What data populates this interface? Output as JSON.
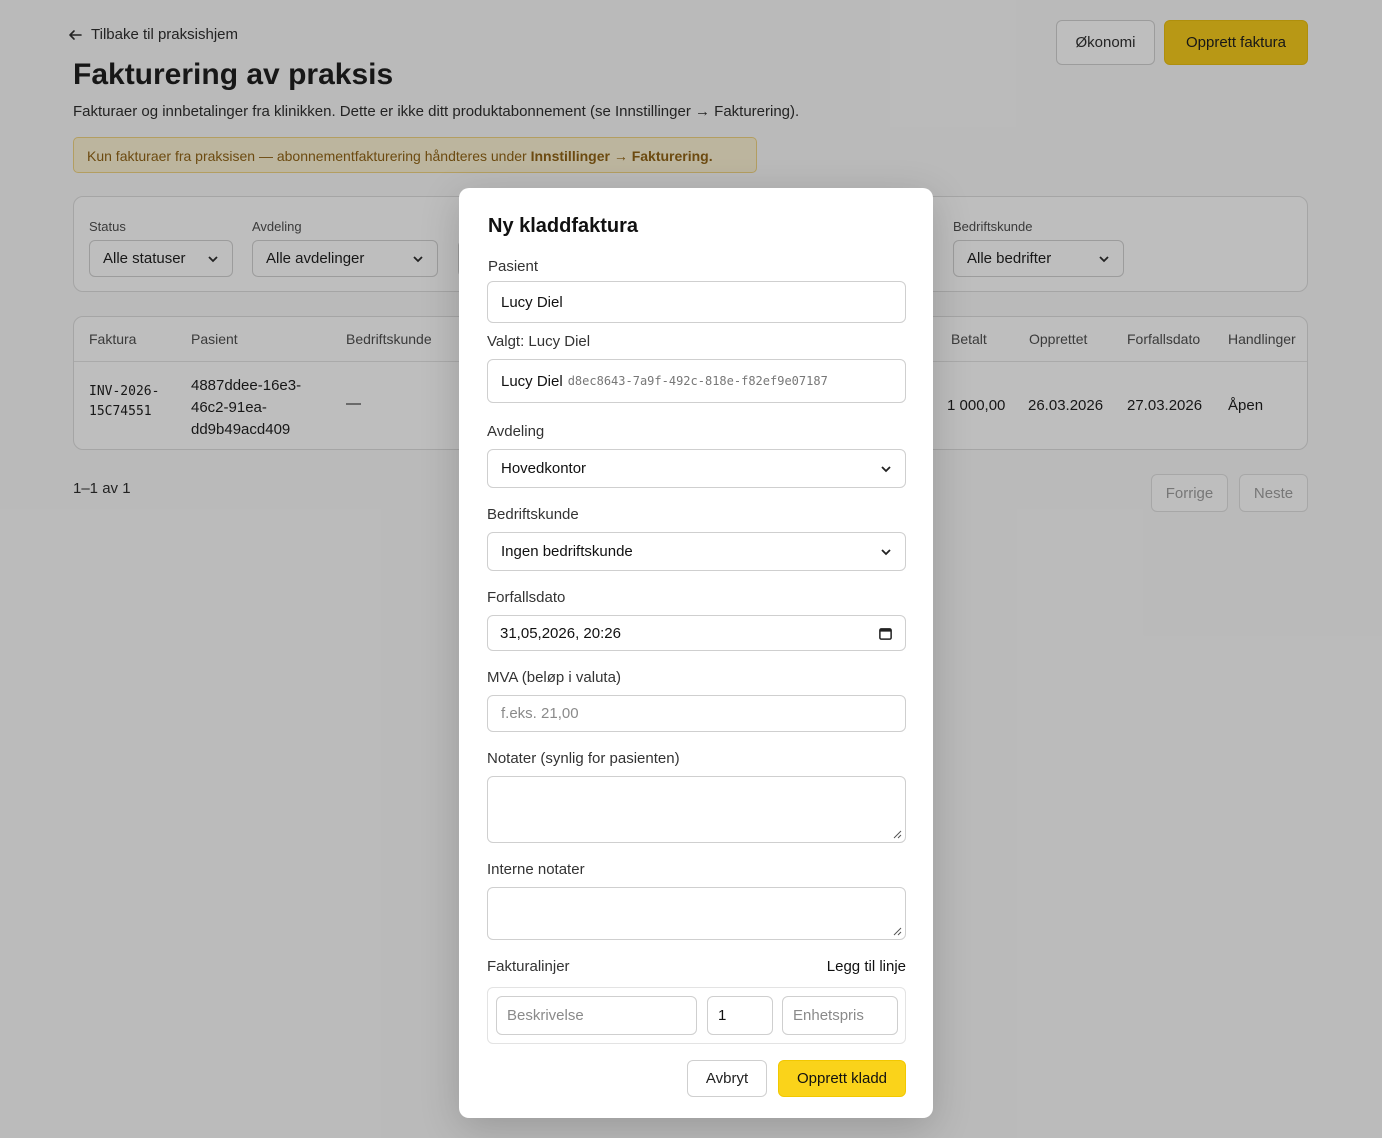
{
  "page": {
    "back_label": "Tilbake til praksishjem",
    "title": "Fakturering av praksis",
    "subtitle": "Fakturaer og innbetalinger fra klinikken. Dette er ikke ditt produktabonnement (se Innstillinger → Fakturering).",
    "notice_text": "Kun fakturaer fra praksisen — abonnementfakturering håndteres under ",
    "notice_link": "Innstillinger → Fakturering.",
    "economy_button": "Økonomi",
    "create_invoice_button": "Opprett faktura"
  },
  "filters": {
    "status_label": "Status",
    "status_value": "Alle statuser",
    "department_label": "Avdeling",
    "department_value": "Alle avdelinger",
    "company_label": "Bedriftskunde",
    "company_value": "Alle bedrifter"
  },
  "table": {
    "headers": {
      "invoice": "Faktura",
      "patient": "Pasient",
      "company": "Bedriftskunde",
      "paid": "Betalt",
      "created": "Opprettet",
      "due": "Forfallsdato",
      "actions": "Handlinger"
    },
    "rows": [
      {
        "invoice_line1": "INV-2026-",
        "invoice_line2": "15C74551",
        "patient_line1": "4887ddee-16e3-",
        "patient_line2": "46c2-91ea-",
        "patient_line3": "dd9b49acd409",
        "company": "—",
        "paid": "1 000,00",
        "created": "26.03.2026",
        "due": "27.03.2026",
        "status": "Åpen"
      }
    ],
    "range": "1–1 av 1",
    "prev": "Forrige",
    "next": "Neste"
  },
  "modal": {
    "title": "Ny kladdfaktura",
    "patient_label": "Pasient",
    "patient_value": "Lucy Diel",
    "selected_label": "Valgt: Lucy Diel",
    "selected_name": "Lucy Diel",
    "selected_id": "d8ec8643-7a9f-492c-818e-f82ef9e07187",
    "department_label": "Avdeling",
    "department_value": "Hovedkontor",
    "company_label": "Bedriftskunde",
    "company_value": "Ingen bedriftskunde",
    "due_label": "Forfallsdato",
    "due_value": "31,05,2026, 20:26",
    "vat_label": "MVA (beløp i valuta)",
    "vat_placeholder": "f.eks. 21,00",
    "notes_label": "Notater (synlig for pasienten)",
    "internal_label": "Interne notater",
    "lines_label": "Fakturalinjer",
    "add_line": "Legg til linje",
    "line_desc_placeholder": "Beskrivelse",
    "line_qty_value": "1",
    "line_price_placeholder": "Enhetspris",
    "cancel": "Avbryt",
    "submit": "Opprett kladd"
  }
}
